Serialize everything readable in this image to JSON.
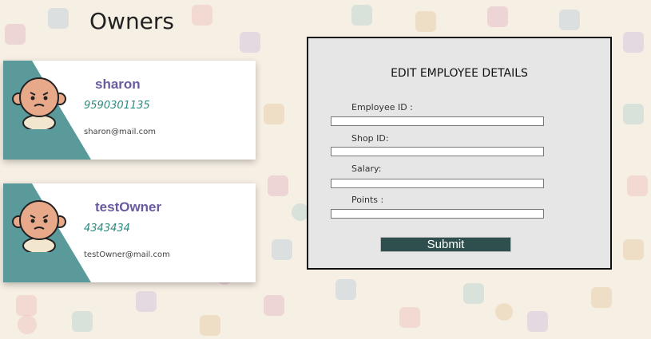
{
  "page": {
    "title": "Owners"
  },
  "owners": [
    {
      "name": "sharon",
      "phone": "9590301135",
      "email": "sharon@mail.com"
    },
    {
      "name": "testOwner",
      "phone": "4343434",
      "email": "testOwner@mail.com"
    }
  ],
  "form": {
    "title": "EDIT EMPLOYEE DETAILS",
    "fields": [
      {
        "label": "Employee ID :",
        "value": ""
      },
      {
        "label": "Shop ID:",
        "value": ""
      },
      {
        "label": "Salary:",
        "value": ""
      },
      {
        "label": "Points :",
        "value": ""
      }
    ],
    "submit_label": "Submit"
  },
  "colors": {
    "card_accent": "#5b9a9a",
    "owner_name": "#6a5aa0",
    "owner_phone": "#2b8a7e",
    "submit_bg": "#2f4f4f",
    "panel_bg": "#e6e6e6"
  }
}
